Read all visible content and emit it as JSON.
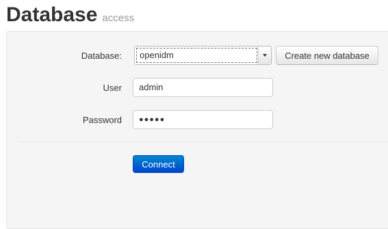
{
  "header": {
    "title": "Database",
    "subtitle": "access"
  },
  "form": {
    "database_label": "Database:",
    "database_selected": "openidm",
    "create_button_label": "Create new database",
    "user_label": "User",
    "user_value": "admin",
    "password_label": "Password",
    "password_mask": "●●●●●",
    "connect_button_label": "Connect"
  },
  "colors": {
    "primary_button": "#0055cc",
    "panel_background": "#f5f5f5"
  },
  "icons": {
    "select_arrow": "chevron-down-icon"
  }
}
